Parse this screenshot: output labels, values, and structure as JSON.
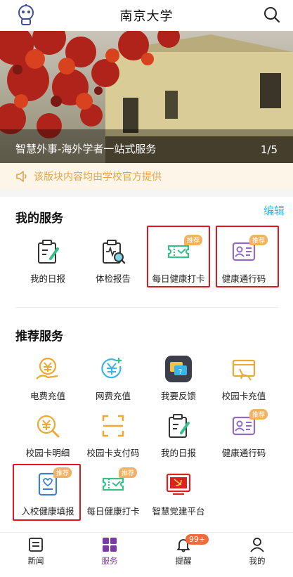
{
  "header": {
    "title": "南京大学"
  },
  "banner": {
    "caption": "智慧外事-海外学者一站式服务",
    "pager": "1/5"
  },
  "notice": {
    "text": "该版块内容均由学校官方提供"
  },
  "my_services": {
    "title": "我的服务",
    "edit_label": "编辑",
    "items": [
      {
        "label": "我的日报",
        "icon": "daily-report-icon"
      },
      {
        "label": "体检报告",
        "icon": "checkup-report-icon"
      },
      {
        "label": "每日健康打卡",
        "icon": "health-checkin-icon",
        "badge": "推荐"
      },
      {
        "label": "健康通行码",
        "icon": "health-pass-icon",
        "badge": "推荐"
      }
    ]
  },
  "recommended": {
    "title": "推荐服务",
    "items": [
      {
        "label": "电费充值",
        "icon": "electricity-recharge-icon"
      },
      {
        "label": "网费充值",
        "icon": "network-recharge-icon"
      },
      {
        "label": "我要反馈",
        "icon": "feedback-icon"
      },
      {
        "label": "校园卡充值",
        "icon": "campus-card-recharge-icon"
      },
      {
        "label": "校园卡明细",
        "icon": "campus-card-detail-icon"
      },
      {
        "label": "校园卡支付码",
        "icon": "campus-card-paycode-icon"
      },
      {
        "label": "我的日报",
        "icon": "daily-report-icon"
      },
      {
        "label": "健康通行码",
        "icon": "health-pass-icon",
        "badge": "推荐"
      },
      {
        "label": "入校健康填报",
        "icon": "campus-entry-health-icon",
        "badge": "推荐"
      },
      {
        "label": "每日健康打卡",
        "icon": "health-checkin-icon",
        "badge": "推荐"
      },
      {
        "label": "智慧党建平台",
        "icon": "party-building-icon"
      }
    ]
  },
  "bottom_nav": {
    "items": [
      {
        "label": "新闻",
        "icon": "news-icon"
      },
      {
        "label": "服务",
        "icon": "services-icon",
        "active": true
      },
      {
        "label": "提醒",
        "icon": "bell-icon",
        "badge": "99+"
      },
      {
        "label": "我的",
        "icon": "profile-icon"
      }
    ]
  },
  "colors": {
    "accent": "#7b3aa6",
    "highlight_box": "#e0181e",
    "badge": "#f2b264",
    "edit_link": "#3bb4e6",
    "notice_text": "#e0a54d"
  }
}
